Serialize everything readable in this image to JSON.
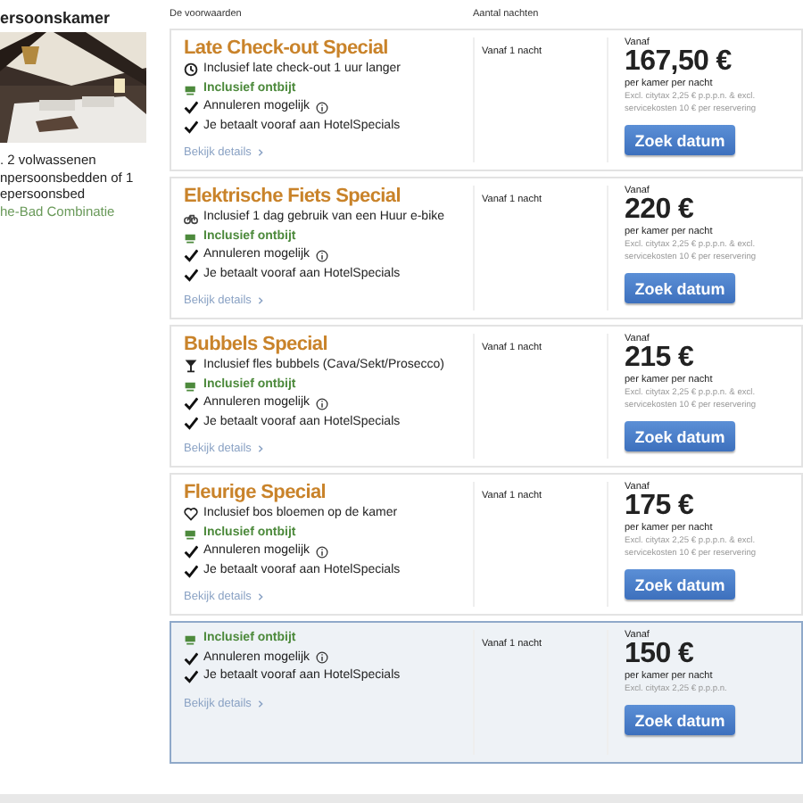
{
  "room": {
    "title": "ersoonskamer",
    "lines": [
      ". 2 volwassenen",
      "npersoonsbedden of 1",
      "epersoonsbed"
    ],
    "combination": "he-Bad Combinatie"
  },
  "columns": [
    "De voorwaarden",
    "Aantal nachten"
  ],
  "offers": [
    {
      "title": "Late Check-out Special",
      "selected": false,
      "features": [
        {
          "kind": "clock",
          "text": "Inclusief late check-out 1 uur langer",
          "info": false
        },
        {
          "kind": "breakfast",
          "text": "Inclusief ontbijt",
          "info": false
        },
        {
          "kind": "check",
          "text": "Annuleren mogelijk",
          "info": true
        },
        {
          "kind": "check",
          "text": "Je betaalt vooraf aan HotelSpecials",
          "info": false
        }
      ],
      "details": "Bekijk details",
      "nights": "Vanaf 1 nacht",
      "from": "Vanaf",
      "price": "167,50 €",
      "per": "per kamer per nacht",
      "note": "Excl. citytax 2,25 € p.p.p.n. & excl. servicekosten 10 € per reservering",
      "button": "Zoek datum"
    },
    {
      "title": "Elektrische Fiets Special",
      "selected": false,
      "features": [
        {
          "kind": "bike",
          "text": "Inclusief 1 dag gebruik van een Huur e-bike",
          "info": false
        },
        {
          "kind": "breakfast",
          "text": "Inclusief ontbijt",
          "info": false
        },
        {
          "kind": "check",
          "text": "Annuleren mogelijk",
          "info": true
        },
        {
          "kind": "check",
          "text": "Je betaalt vooraf aan HotelSpecials",
          "info": false
        }
      ],
      "details": "Bekijk details",
      "nights": "Vanaf 1 nacht",
      "from": "Vanaf",
      "price": "220 €",
      "per": "per kamer per nacht",
      "note": "Excl. citytax 2,25 € p.p.p.n. & excl. servicekosten 10 € per reservering",
      "button": "Zoek datum"
    },
    {
      "title": "Bubbels Special",
      "selected": false,
      "features": [
        {
          "kind": "glass",
          "text": "Inclusief fles bubbels (Cava/Sekt/Prosecco)",
          "info": false
        },
        {
          "kind": "breakfast",
          "text": "Inclusief ontbijt",
          "info": false
        },
        {
          "kind": "check",
          "text": "Annuleren mogelijk",
          "info": true
        },
        {
          "kind": "check",
          "text": "Je betaalt vooraf aan HotelSpecials",
          "info": false
        }
      ],
      "details": "Bekijk details",
      "nights": "Vanaf 1 nacht",
      "from": "Vanaf",
      "price": "215 €",
      "per": "per kamer per nacht",
      "note": "Excl. citytax 2,25 € p.p.p.n. & excl. servicekosten 10 € per reservering",
      "button": "Zoek datum"
    },
    {
      "title": "Fleurige Special",
      "selected": false,
      "features": [
        {
          "kind": "heart",
          "text": "Inclusief bos bloemen op de kamer",
          "info": false
        },
        {
          "kind": "breakfast",
          "text": "Inclusief ontbijt",
          "info": false
        },
        {
          "kind": "check",
          "text": "Annuleren mogelijk",
          "info": true
        },
        {
          "kind": "check",
          "text": "Je betaalt vooraf aan HotelSpecials",
          "info": false
        }
      ],
      "details": "Bekijk details",
      "nights": "Vanaf 1 nacht",
      "from": "Vanaf",
      "price": "175 €",
      "per": "per kamer per nacht",
      "note": "Excl. citytax 2,25 € p.p.p.n. & excl. servicekosten 10 € per reservering",
      "button": "Zoek datum"
    },
    {
      "selected": true,
      "features": [
        {
          "kind": "breakfast",
          "text": "Inclusief ontbijt",
          "info": false
        },
        {
          "kind": "check",
          "text": "Annuleren mogelijk",
          "info": true
        },
        {
          "kind": "check",
          "text": "Je betaalt vooraf aan HotelSpecials",
          "info": false
        }
      ],
      "details": "Bekijk details",
      "nights": "Vanaf 1 nacht",
      "from": "Vanaf",
      "price": "150 €",
      "per": "per kamer per nacht",
      "note": "Excl. citytax 2,25 € p.p.p.n.",
      "button": "Zoek datum"
    }
  ]
}
